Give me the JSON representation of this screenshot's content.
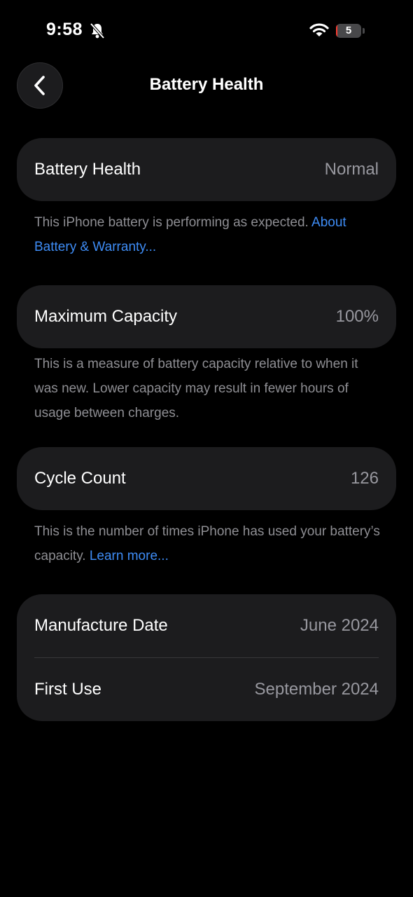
{
  "status_bar": {
    "time": "9:58",
    "battery_level": "5",
    "battery_fraction": 0.05,
    "icons": [
      "bell-slash-icon",
      "wifi-icon",
      "battery-icon"
    ]
  },
  "nav": {
    "back_icon": "chevron-left-icon",
    "title": "Battery Health"
  },
  "battery_health": {
    "label": "Battery Health",
    "value": "Normal",
    "footnote": "This iPhone battery is performing as expected.",
    "link": "About Battery & Warranty..."
  },
  "maximum_capacity": {
    "label": "Maximum Capacity",
    "value": "100%",
    "footnote": "This is a measure of battery capacity relative to when it was new. Lower capacity may result in fewer hours of usage between charges."
  },
  "cycle_count": {
    "label": "Cycle Count",
    "value": "126",
    "footnote": "This is the number of times iPhone has used your battery’s capacity.",
    "link": "Learn more..."
  },
  "dates": {
    "manufacture_label": "Manufacture Date",
    "manufacture_value": "June 2024",
    "first_use_label": "First Use",
    "first_use_value": "September 2024"
  },
  "colors": {
    "background": "#000000",
    "card": "#1c1c1e",
    "secondary_text": "#8e8e93",
    "link": "#3e8cf5",
    "battery_low": "#ff3b30"
  }
}
